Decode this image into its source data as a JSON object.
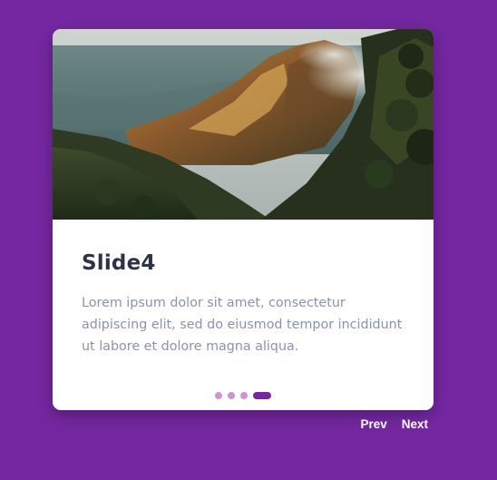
{
  "colors": {
    "background": "#7427a0",
    "card": "#ffffff",
    "title": "#2c3445",
    "body_text": "#8a93ad",
    "dot_inactive": "#d692ce",
    "dot_active": "#7427a0",
    "nav_text": "#ffffff"
  },
  "slider": {
    "slides_total": 4,
    "active_index": 3
  },
  "slide": {
    "title": "Slide4",
    "body": "Lorem ipsum dolor sit amet, consectetur adipiscing elit, sed do eiusmod tempor incididunt ut labore et dolore magna aliqua."
  },
  "navigation": {
    "prev_label": "Prev",
    "next_label": "Next"
  }
}
